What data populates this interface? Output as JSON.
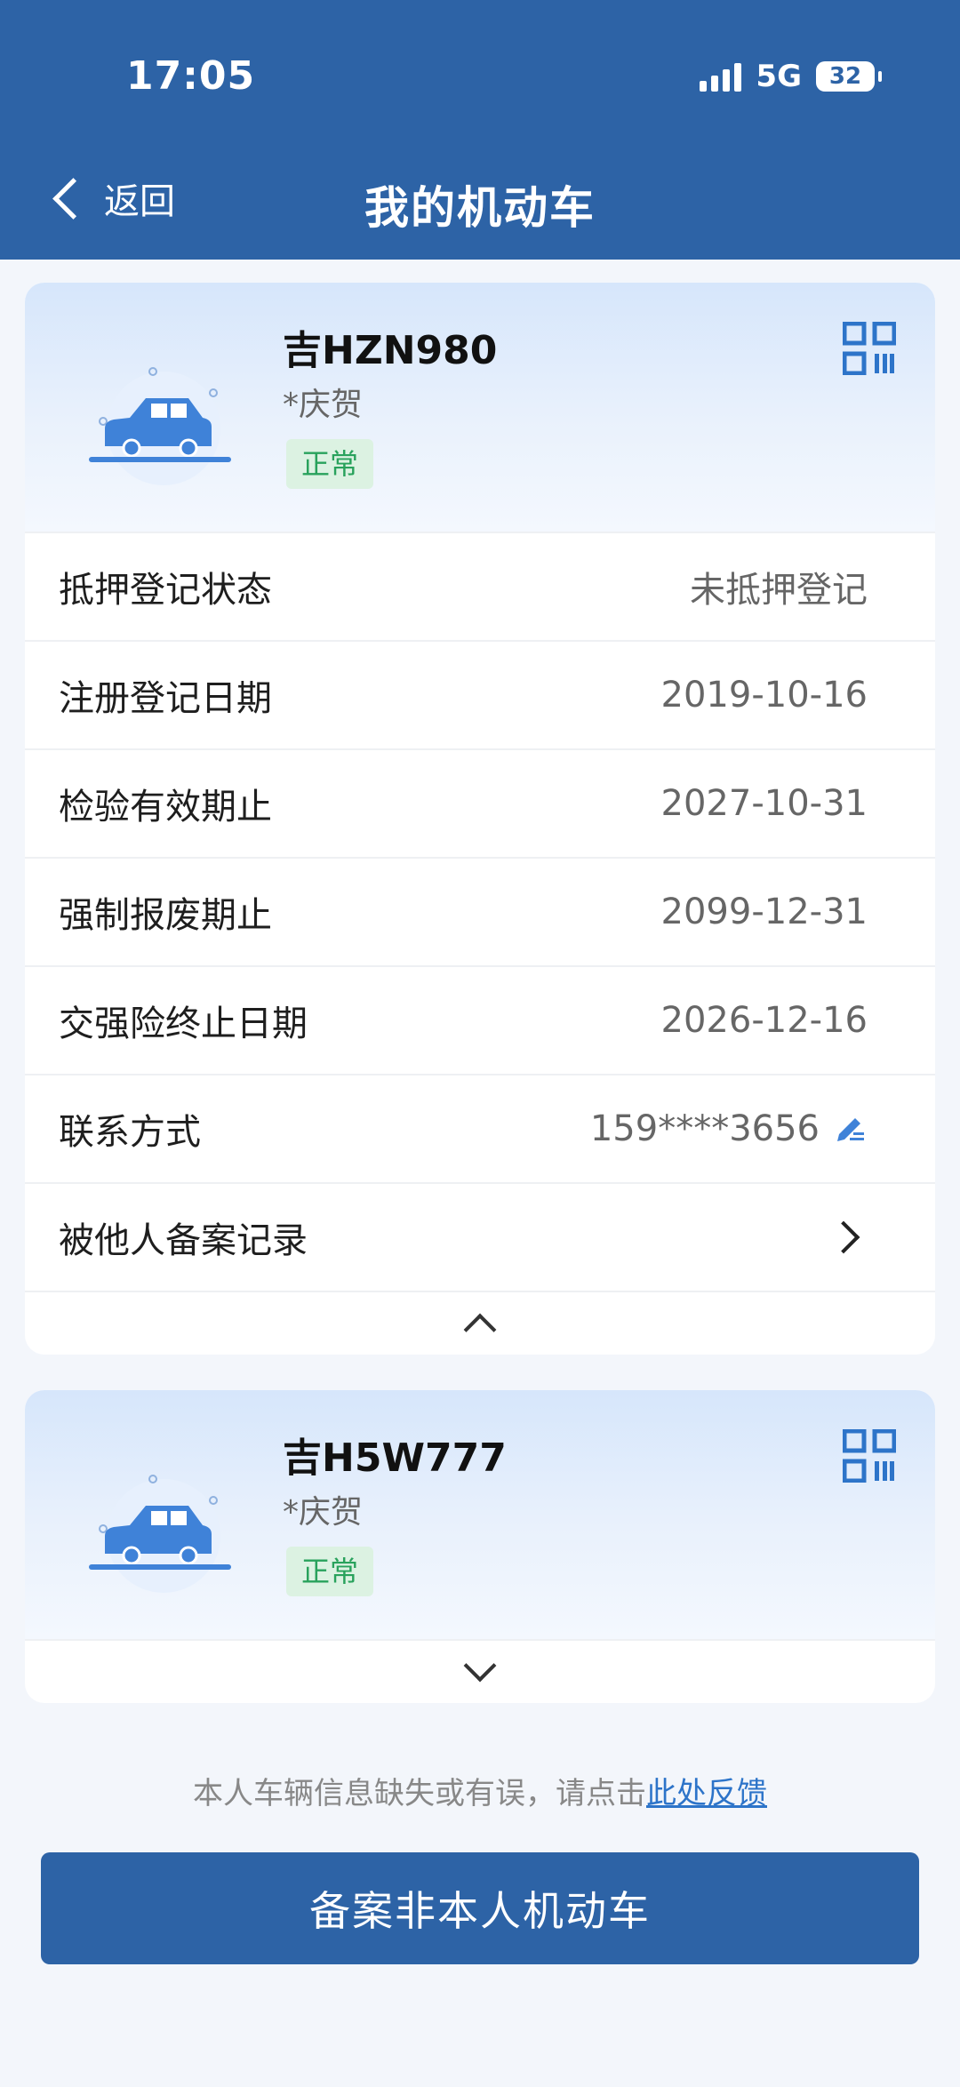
{
  "status_bar": {
    "time": "17:05",
    "network": "5G",
    "battery": "32"
  },
  "header": {
    "back_label": "返回",
    "title": "我的机动车"
  },
  "vehicles": [
    {
      "plate": "吉HZN980",
      "owner": "*庆贺",
      "status": "正常",
      "details": [
        {
          "label": "抵押登记状态",
          "value": "未抵押登记"
        },
        {
          "label": "注册登记日期",
          "value": "2019-10-16"
        },
        {
          "label": "检验有效期止",
          "value": "2027-10-31"
        },
        {
          "label": "强制报废期止",
          "value": "2099-12-31"
        },
        {
          "label": "交强险终止日期",
          "value": "2026-12-16"
        },
        {
          "label": "联系方式",
          "value": "159****3656"
        },
        {
          "label": "被他人备案记录",
          "value": ""
        }
      ],
      "expanded": true
    },
    {
      "plate": "吉H5W777",
      "owner": "*庆贺",
      "status": "正常",
      "expanded": false
    }
  ],
  "feedback": {
    "text": "本人车辆信息缺失或有误，请点击",
    "link": "此处反馈"
  },
  "primary_button": "备案非本人机动车",
  "colors": {
    "brand_blue": "#2d63a6",
    "status_green": "#29a25c",
    "icon_blue": "#2d74c9"
  },
  "icons": [
    "car-icon",
    "qr-code-icon",
    "edit-icon",
    "chevron-right-icon",
    "chevron-up-icon",
    "chevron-down-icon",
    "back-icon"
  ]
}
